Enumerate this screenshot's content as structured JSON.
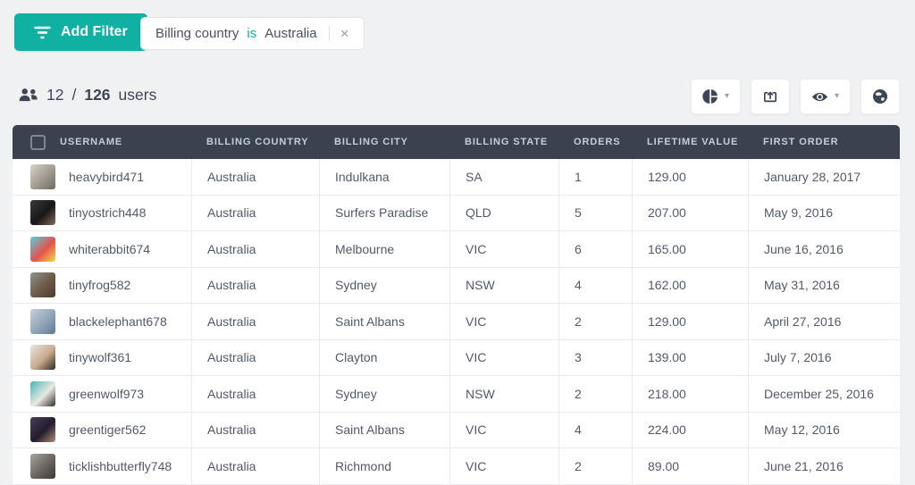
{
  "filter_bar": {
    "add_filter_label": "Add Filter",
    "add_filter_icon": "funnel-lines-icon",
    "filter_chip": {
      "field": "Billing country",
      "operator": "is",
      "value": "Australia",
      "remove_label": "×"
    }
  },
  "summary": {
    "icon": "users-group-icon",
    "shown_count": "12",
    "separator": "/",
    "total_count": "126",
    "unit_label": "users"
  },
  "toolbar": {
    "buttons": [
      {
        "icon": "pie-chart-icon",
        "has_caret": true
      },
      {
        "icon": "export-icon",
        "has_caret": false
      },
      {
        "icon": "eye-icon",
        "has_caret": true
      },
      {
        "icon": "globe-icon",
        "has_caret": false
      }
    ],
    "caret_glyph": "▾"
  },
  "table": {
    "columns": [
      "USERNAME",
      "BILLING COUNTRY",
      "BILLING CITY",
      "BILLING STATE",
      "ORDERS",
      "LIFETIME VALUE",
      "FIRST ORDER"
    ],
    "rows": [
      {
        "username": "heavybird471",
        "billing_country": "Australia",
        "billing_city": "Indulkana",
        "billing_state": "SA",
        "orders": "1",
        "lifetime_value": "129.00",
        "first_order": "January 28, 2017",
        "avatar_colors": [
          "#d8d4cb",
          "#a09a8e",
          "#6f6a60"
        ]
      },
      {
        "username": "tinyostrich448",
        "billing_country": "Australia",
        "billing_city": "Surfers Paradise",
        "billing_state": "QLD",
        "orders": "5",
        "lifetime_value": "207.00",
        "first_order": "May 9, 2016",
        "avatar_colors": [
          "#3a3a3a",
          "#171717",
          "#8a6d5c"
        ]
      },
      {
        "username": "whiterabbit674",
        "billing_country": "Australia",
        "billing_city": "Melbourne",
        "billing_state": "VIC",
        "orders": "6",
        "lifetime_value": "165.00",
        "first_order": "June 16, 2016",
        "avatar_colors": [
          "#55cfe2",
          "#e5524b",
          "#f0dc49"
        ]
      },
      {
        "username": "tinyfrog582",
        "billing_country": "Australia",
        "billing_city": "Sydney",
        "billing_state": "NSW",
        "orders": "4",
        "lifetime_value": "162.00",
        "first_order": "May 31, 2016",
        "avatar_colors": [
          "#8e9492",
          "#6d5846",
          "#4a3c30"
        ]
      },
      {
        "username": "blackelephant678",
        "billing_country": "Australia",
        "billing_city": "Saint Albans",
        "billing_state": "VIC",
        "orders": "2",
        "lifetime_value": "129.00",
        "first_order": "April 27, 2016",
        "avatar_colors": [
          "#c6d0da",
          "#8fa5b8",
          "#5f7892"
        ]
      },
      {
        "username": "tinywolf361",
        "billing_country": "Australia",
        "billing_city": "Clayton",
        "billing_state": "VIC",
        "orders": "3",
        "lifetime_value": "139.00",
        "first_order": "July 7, 2016",
        "avatar_colors": [
          "#e8e6e1",
          "#c9a98d",
          "#2b2926"
        ]
      },
      {
        "username": "greenwolf973",
        "billing_country": "Australia",
        "billing_city": "Sydney",
        "billing_state": "NSW",
        "orders": "2",
        "lifetime_value": "218.00",
        "first_order": "December 25, 2016",
        "avatar_colors": [
          "#45b7b3",
          "#ece9e4",
          "#2f2d2b"
        ]
      },
      {
        "username": "greentiger562",
        "billing_country": "Australia",
        "billing_city": "Saint Albans",
        "billing_state": "VIC",
        "orders": "4",
        "lifetime_value": "224.00",
        "first_order": "May 12, 2016",
        "avatar_colors": [
          "#4a3d56",
          "#241d2e",
          "#b08b74"
        ]
      },
      {
        "username": "ticklishbutterfly748",
        "billing_country": "Australia",
        "billing_city": "Richmond",
        "billing_state": "VIC",
        "orders": "2",
        "lifetime_value": "89.00",
        "first_order": "June 21, 2016",
        "avatar_colors": [
          "#a8a5a2",
          "#6b645e",
          "#3c3835"
        ]
      }
    ]
  },
  "colors": {
    "accent_teal": "#10b0a3",
    "table_header_bg": "#3a4250",
    "page_bg": "#f0f1f3",
    "row_border": "#e9ebee",
    "body_text": "#525a68",
    "header_text": "#c8cdd5"
  }
}
